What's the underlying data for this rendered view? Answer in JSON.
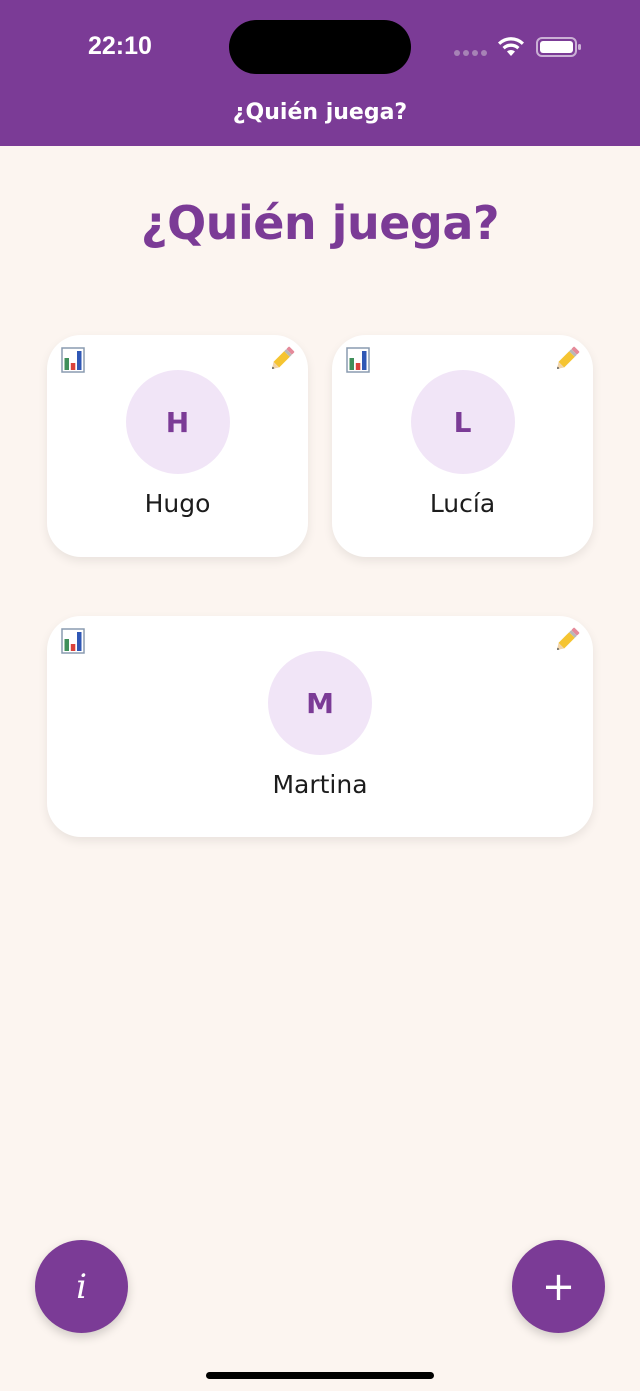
{
  "status_bar": {
    "time": "22:10"
  },
  "header": {
    "title": "¿Quién juega?"
  },
  "page": {
    "title": "¿Quién juega?"
  },
  "players": [
    {
      "initial": "H",
      "name": "Hugo"
    },
    {
      "initial": "L",
      "name": "Lucía"
    },
    {
      "initial": "M",
      "name": "Martina"
    }
  ],
  "buttons": {
    "info_label": "i",
    "add_label": "+"
  },
  "colors": {
    "primary": "#7b3b96",
    "background": "#fcf5f0",
    "avatar_bg": "#f1e5f7",
    "card_bg": "#ffffff"
  },
  "icons": {
    "card_left": "bar-chart-icon",
    "card_right": "pencil-icon"
  }
}
